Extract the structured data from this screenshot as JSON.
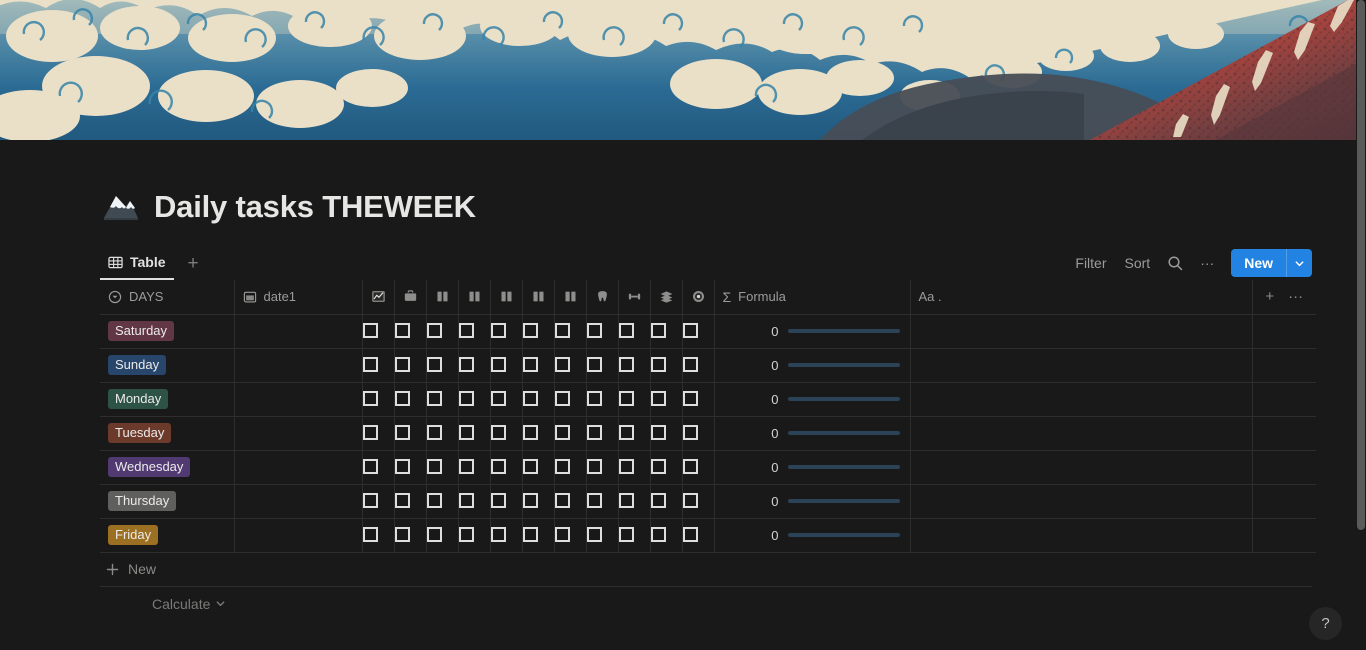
{
  "cover": {
    "name": "hokusai-red-fuji-cover"
  },
  "header": {
    "title": "Daily tasks THEWEEK",
    "icon": "snow-capped-mountain-emoji"
  },
  "tabs": [
    {
      "label": "Table",
      "icon": "table-icon",
      "active": true
    }
  ],
  "tab_add_label": "+",
  "toolbar": {
    "filter_label": "Filter",
    "sort_label": "Sort",
    "search_icon": "search-icon",
    "more_label": "···",
    "new_label": "New",
    "new_caret_icon": "chevron-down-icon"
  },
  "table": {
    "columns": [
      {
        "key": "days",
        "label": "DAYS",
        "icon": "select-property-icon",
        "type": "select"
      },
      {
        "key": "date1",
        "label": "date1",
        "icon": "calendar-icon",
        "type": "date"
      },
      {
        "key": "chk1",
        "label": "",
        "icon": "chart-increasing-emoji",
        "type": "checkbox"
      },
      {
        "key": "chk2",
        "label": "",
        "icon": "briefcase-emoji",
        "type": "checkbox"
      },
      {
        "key": "chk3",
        "label": "",
        "icon": "open-book-emoji",
        "type": "checkbox"
      },
      {
        "key": "chk4",
        "label": "",
        "icon": "open-book-emoji",
        "type": "checkbox"
      },
      {
        "key": "chk5",
        "label": "",
        "icon": "open-book-emoji",
        "type": "checkbox"
      },
      {
        "key": "chk6",
        "label": "",
        "icon": "open-book-emoji",
        "type": "checkbox"
      },
      {
        "key": "chk7",
        "label": "",
        "icon": "open-book-emoji",
        "type": "checkbox"
      },
      {
        "key": "chk8",
        "label": "",
        "icon": "tooth-emoji",
        "type": "checkbox"
      },
      {
        "key": "chk9",
        "label": "",
        "icon": "dumbbell-emoji",
        "type": "checkbox"
      },
      {
        "key": "chk10",
        "label": "",
        "icon": "stack-layers-emoji",
        "type": "checkbox"
      },
      {
        "key": "chk11",
        "label": "",
        "icon": "record-target-emoji",
        "type": "checkbox"
      },
      {
        "key": "formula",
        "label": "Formula",
        "icon": "sigma-icon",
        "type": "formula"
      },
      {
        "key": "aa",
        "label": "Aa .",
        "icon": "",
        "type": "text"
      }
    ],
    "header_actions": {
      "add_icon": "plus-icon",
      "more_icon": "ellipsis-icon"
    },
    "rows": [
      {
        "day": "Saturday",
        "day_color": "#613745",
        "date1": "",
        "checks": [
          false,
          false,
          false,
          false,
          false,
          false,
          false,
          false,
          false,
          false,
          false
        ],
        "formula": "0",
        "progress": 0,
        "aa": ""
      },
      {
        "day": "Sunday",
        "day_color": "#28456c",
        "date1": "",
        "checks": [
          false,
          false,
          false,
          false,
          false,
          false,
          false,
          false,
          false,
          false,
          false
        ],
        "formula": "0",
        "progress": 0,
        "aa": ""
      },
      {
        "day": "Monday",
        "day_color": "#2c5346",
        "date1": "",
        "checks": [
          false,
          false,
          false,
          false,
          false,
          false,
          false,
          false,
          false,
          false,
          false
        ],
        "formula": "0",
        "progress": 0,
        "aa": ""
      },
      {
        "day": "Tuesday",
        "day_color": "#6b3a2b",
        "date1": "",
        "checks": [
          false,
          false,
          false,
          false,
          false,
          false,
          false,
          false,
          false,
          false,
          false
        ],
        "formula": "0",
        "progress": 0,
        "aa": ""
      },
      {
        "day": "Wednesday",
        "day_color": "#503a71",
        "date1": "",
        "checks": [
          false,
          false,
          false,
          false,
          false,
          false,
          false,
          false,
          false,
          false,
          false
        ],
        "formula": "0",
        "progress": 0,
        "aa": ""
      },
      {
        "day": "Thursday",
        "day_color": "#5f5f5d",
        "date1": "",
        "checks": [
          false,
          false,
          false,
          false,
          false,
          false,
          false,
          false,
          false,
          false,
          false
        ],
        "formula": "0",
        "progress": 0,
        "aa": ""
      },
      {
        "day": "Friday",
        "day_color": "#9b7023",
        "date1": "",
        "checks": [
          false,
          false,
          false,
          false,
          false,
          false,
          false,
          false,
          false,
          false,
          false
        ],
        "formula": "0",
        "progress": 0,
        "aa": ""
      }
    ]
  },
  "footer": {
    "new_row_label": "New",
    "new_row_icon": "plus-icon",
    "calculate_label": "Calculate",
    "calculate_caret_icon": "chevron-down-icon"
  },
  "help_button": {
    "label": "?"
  },
  "colors": {
    "accent_blue": "#2383e2",
    "page_bg": "#191919",
    "border": "#2e2e2c",
    "progress_track": "#2c4257"
  }
}
